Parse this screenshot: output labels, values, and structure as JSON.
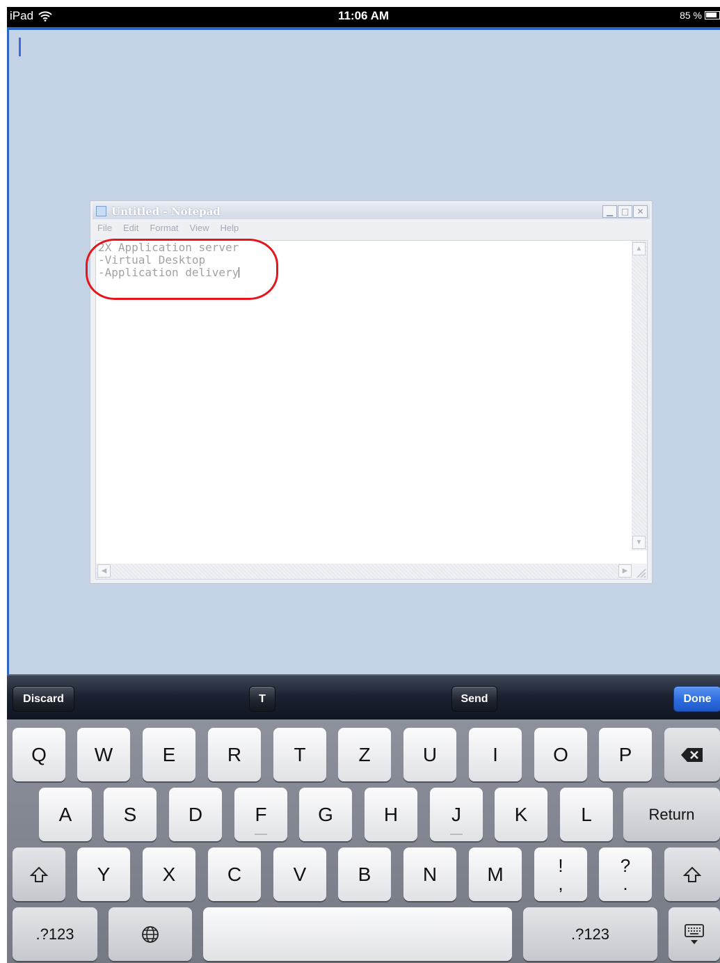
{
  "status_bar": {
    "device": "iPad",
    "time": "11:06 AM",
    "battery": "85 %"
  },
  "notepad": {
    "title": "Untitled - Notepad",
    "menus": [
      "File",
      "Edit",
      "Format",
      "View",
      "Help"
    ],
    "lines": [
      "2X Application server",
      "-Virtual Desktop",
      "-Application delivery"
    ]
  },
  "toolbar": {
    "discard_label": "Discard",
    "format_label": "T",
    "send_label": "Send",
    "done_label": "Done"
  },
  "keyboard": {
    "row1": [
      "Q",
      "W",
      "E",
      "R",
      "T",
      "Z",
      "U",
      "I",
      "O",
      "P"
    ],
    "row2": [
      "A",
      "S",
      "D",
      "F",
      "G",
      "H",
      "J",
      "K",
      "L"
    ],
    "return_label": "Return",
    "row3": [
      "Y",
      "X",
      "C",
      "V",
      "B",
      "N",
      "M"
    ],
    "punct1": [
      "!",
      ","
    ],
    "punct2": [
      "?",
      "."
    ],
    "numbers_label": ".?123"
  },
  "annotation": {
    "color": "#e6141c"
  },
  "accent_color": "#2b65c8"
}
